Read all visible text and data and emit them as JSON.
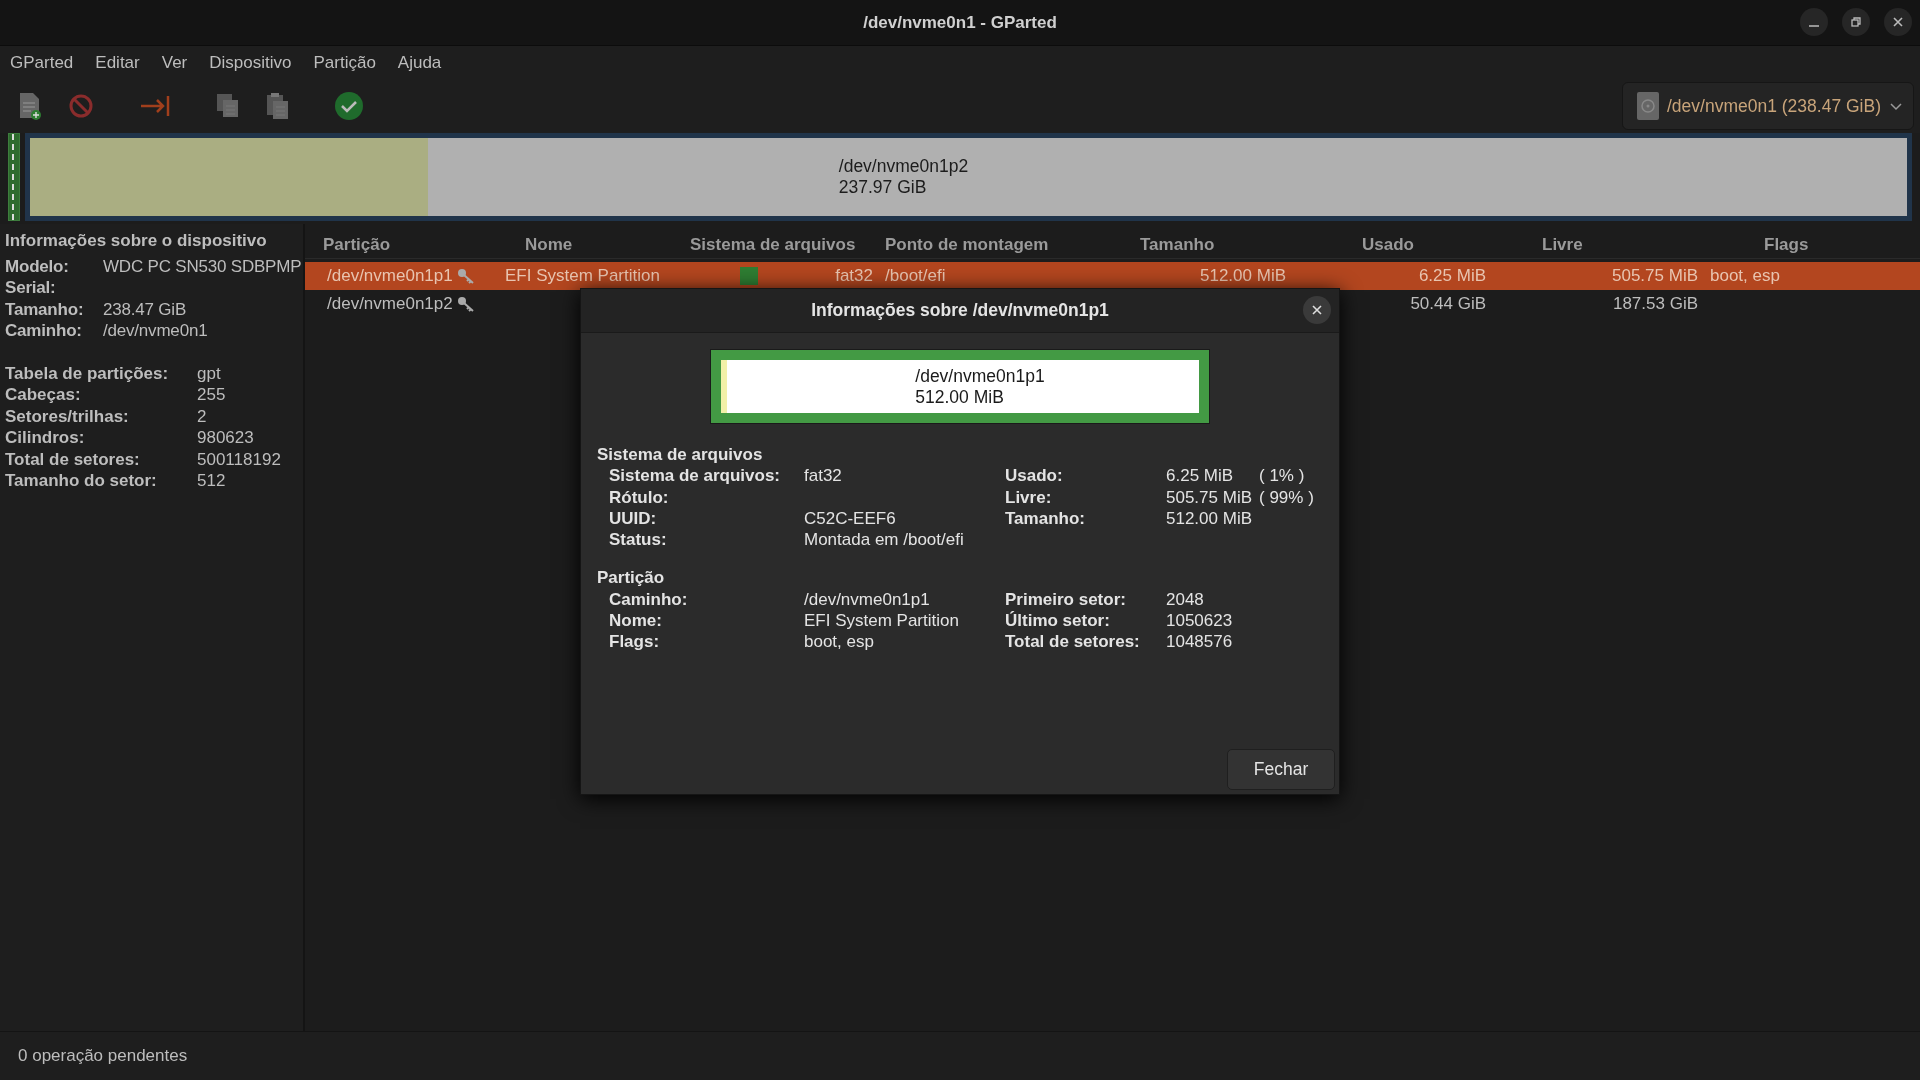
{
  "window": {
    "title": "/dev/nvme0n1 - GParted"
  },
  "menu": [
    "GParted",
    "Editar",
    "Ver",
    "Dispositivo",
    "Partição",
    "Ajuda"
  ],
  "device_selector": {
    "label": "/dev/nvme0n1 (238.47 GiB)"
  },
  "disk_map": {
    "path": "/dev/nvme0n1p2",
    "size": "237.97 GiB",
    "level": 0.212
  },
  "device_info": {
    "title": "Informações sobre o dispositivo",
    "fields": [
      {
        "label": "Modelo:",
        "value": "WDC PC SN530 SDBPMP"
      },
      {
        "label": "Serial:"
      },
      {
        "label": "Tamanho:",
        "value": "238.47 GiB"
      },
      {
        "label": "Caminho:",
        "value": "/dev/nvme0n1"
      }
    ],
    "table_fields": [
      {
        "label": "Tabela de partições:",
        "value": "gpt"
      },
      {
        "label": "Cabeças:",
        "value": "255"
      },
      {
        "label": "Setores/trilhas:",
        "value": "2"
      },
      {
        "label": "Cilindros:",
        "value": "980623"
      },
      {
        "label": "Total de setores:",
        "value": "500118192"
      },
      {
        "label": "Tamanho do setor:",
        "value": "512"
      }
    ]
  },
  "partitions": {
    "columns": [
      "Partição",
      "Nome",
      "Sistema de arquivos",
      "Ponto de montagem",
      "Tamanho",
      "Usado",
      "Livre",
      "Flags"
    ],
    "rows": [
      {
        "partition": "/dev/nvme0n1p1",
        "name": "EFI System Partition",
        "filesystem": "fat32",
        "color": "#2e7d32",
        "mount": "/boot/efi",
        "size": "512.00 MiB",
        "used": "6.25 MiB",
        "free": "505.75 MiB",
        "flags": "boot, esp",
        "selected": true
      },
      {
        "partition": "/dev/nvme0n1p2",
        "used": "50.44 GiB",
        "free": "187.53 GiB",
        "selected": false
      }
    ]
  },
  "dialog": {
    "title": "Informações sobre /dev/nvme0n1p1",
    "graph": {
      "path": "/dev/nvme0n1p1",
      "size": "512.00 MiB",
      "level": 0.012
    },
    "sections": [
      {
        "title": "Sistema de arquivos",
        "left": [
          {
            "label": "Sistema de arquivos:",
            "value": "fat32"
          },
          {
            "label": "Rótulo:"
          },
          {
            "label": "UUID:",
            "value": "C52C-EEF6"
          },
          {
            "label": "Status:",
            "value": "Montada em /boot/efi"
          }
        ],
        "right": [
          {
            "label": "Usado:",
            "value": "6.25 MiB",
            "percent": "( 1% )"
          },
          {
            "label": "Livre:",
            "value": "505.75 MiB",
            "percent": "( 99% )"
          },
          {
            "label": "Tamanho:",
            "value": "512.00 MiB"
          }
        ]
      },
      {
        "title": "Partição",
        "left": [
          {
            "label": "Caminho:",
            "value": "/dev/nvme0n1p1"
          },
          {
            "label": "Nome:",
            "value": "EFI System Partition"
          },
          {
            "label": "Flags:",
            "value": "boot, esp"
          }
        ],
        "right": [
          {
            "label": "Primeiro setor:",
            "value": "2048"
          },
          {
            "label": "Último setor:",
            "value": "1050623"
          },
          {
            "label": "Total de setores:",
            "value": "1048576"
          }
        ]
      }
    ],
    "close_button": "Fechar"
  },
  "status_bar": "0 operação pendentes"
}
